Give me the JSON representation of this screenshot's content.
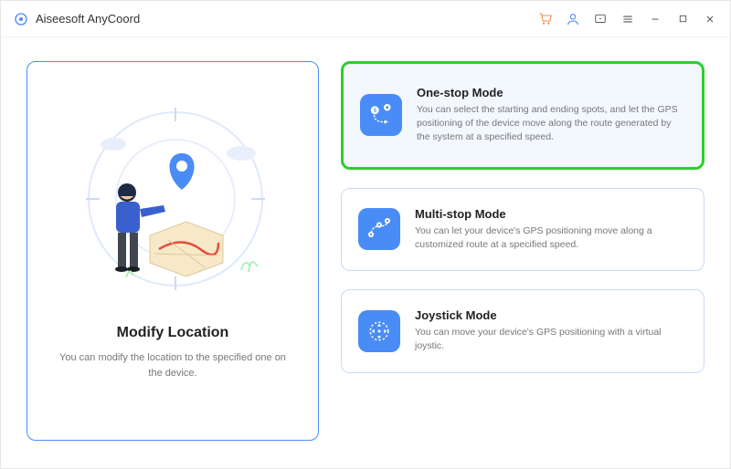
{
  "app": {
    "title": "Aiseesoft AnyCoord"
  },
  "left": {
    "title": "Modify Location",
    "desc": "You can modify the location to the specified one on the device."
  },
  "modes": [
    {
      "title": "One-stop Mode",
      "desc": "You can select the starting and ending spots, and let the GPS positioning of the device move along the route generated by the system at a specified speed."
    },
    {
      "title": "Multi-stop Mode",
      "desc": "You can let your device's GPS positioning move along a customized route at a specified speed."
    },
    {
      "title": "Joystick Mode",
      "desc": "You can move your device's GPS positioning with a virtual joystic."
    }
  ]
}
